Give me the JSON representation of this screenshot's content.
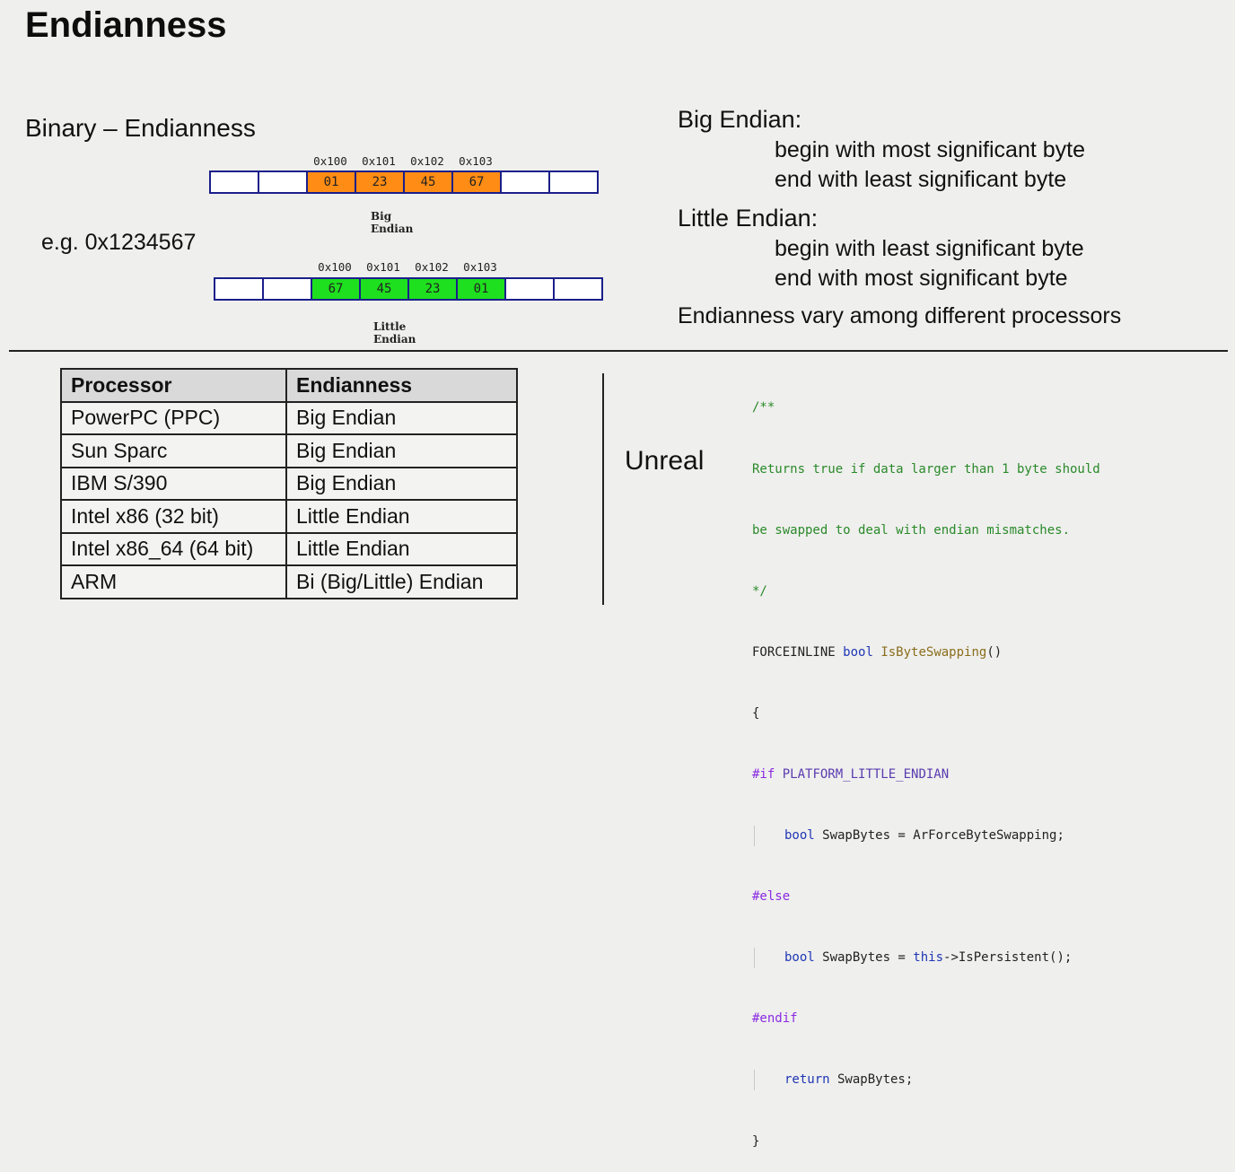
{
  "title": "Endianness",
  "subtitle": "Binary – Endianness",
  "example": "e.g. 0x1234567",
  "big_diagram": {
    "addresses": [
      "0x100",
      "0x101",
      "0x102",
      "0x103"
    ],
    "cells": [
      "",
      "",
      "01",
      "23",
      "45",
      "67",
      "",
      ""
    ],
    "caption": "Big Endian"
  },
  "little_diagram": {
    "addresses": [
      "0x100",
      "0x101",
      "0x102",
      "0x103"
    ],
    "cells": [
      "",
      "",
      "67",
      "45",
      "23",
      "01",
      "",
      ""
    ],
    "caption": "Little Endian"
  },
  "definitions": {
    "big_heading": "Big Endian:",
    "big_lines": [
      "begin with most significant byte",
      "end with least significant byte"
    ],
    "little_heading": "Little Endian:",
    "little_lines": [
      "begin with least significant byte",
      "end with most significant byte"
    ],
    "note": "Endianness vary among different processors"
  },
  "table": {
    "headers": [
      "Processor",
      "Endianness"
    ],
    "rows": [
      [
        "PowerPC (PPC)",
        "Big Endian"
      ],
      [
        "Sun Sparc",
        "Big Endian"
      ],
      [
        "IBM S/390",
        "Big Endian"
      ],
      [
        "Intel x86 (32 bit)",
        "Little Endian"
      ],
      [
        "Intel x86_64 (64 bit)",
        "Little Endian"
      ],
      [
        "ARM",
        "Bi (Big/Little) Endian"
      ]
    ]
  },
  "unreal_label": "Unreal",
  "code": {
    "comment_open": "/**",
    "comment_l1": "Returns true if data larger than 1 byte should",
    "comment_l2": "be swapped to deal with endian mismatches.",
    "comment_close": "*/",
    "sig_macro": "FORCEINLINE",
    "sig_type": "bool",
    "sig_fn": "IsByteSwapping",
    "sig_parens": "()",
    "brace_open": "{",
    "if_directive": "#if",
    "if_macro": "PLATFORM_LITTLE_ENDIAN",
    "l1_type": "bool",
    "l1_rest": " SwapBytes = ArForceByteSwapping;",
    "else_directive": "#else",
    "l2_type": "bool",
    "l2_mid": " SwapBytes = ",
    "l2_this": "this",
    "l2_rest": "->IsPersistent();",
    "endif_directive": "#endif",
    "ret_kw": "return",
    "ret_rest": " SwapBytes;",
    "brace_close": "}"
  },
  "colors": {
    "big_highlight": "#ff8c14",
    "little_highlight": "#1ee01e",
    "memory_border": "#1b1f8a"
  }
}
